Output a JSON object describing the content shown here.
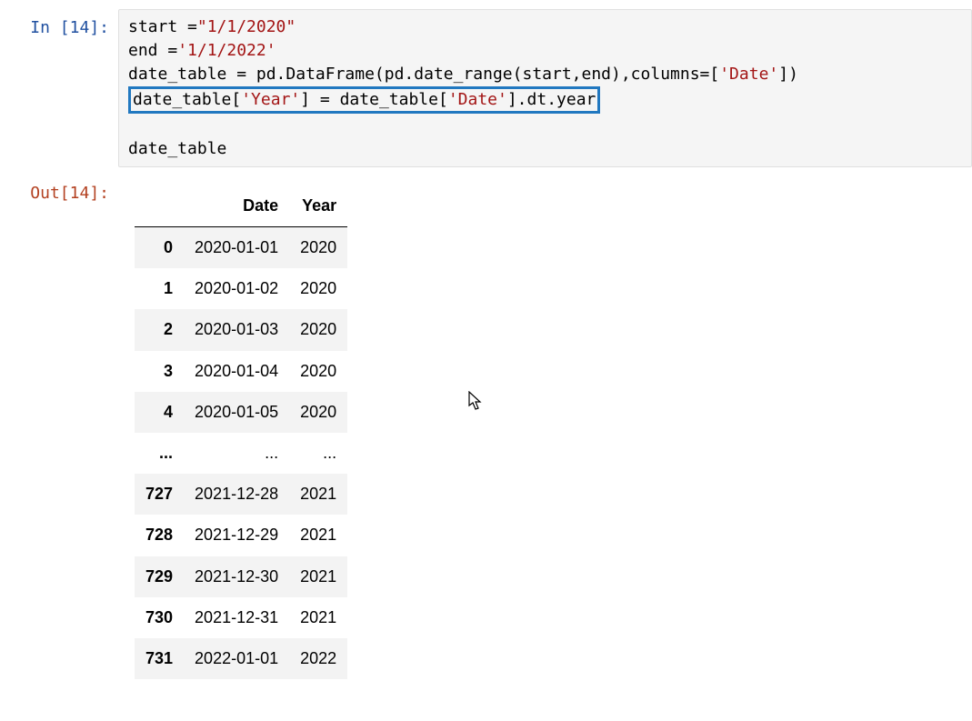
{
  "input": {
    "prompt_prefix": "In [",
    "number": "14",
    "prompt_suffix": "]:",
    "code": {
      "l1a": "start =",
      "l1b": "\"1/1/2020\"",
      "l2a": "end =",
      "l2b": "'1/1/2022'",
      "l3a": "date_table = pd.DataFrame(pd.date_range(start,end),columns=[",
      "l3b": "'Date'",
      "l3c": "])",
      "l4a": "date_table[",
      "l4b": "'Year'",
      "l4c": "] = date_table[",
      "l4d": "'Date'",
      "l4e": "].dt.year",
      "l5": "date_table"
    }
  },
  "output": {
    "prompt_prefix": "Out[",
    "number": "14",
    "prompt_suffix": "]:",
    "columns": {
      "index": "",
      "date": "Date",
      "year": "Year"
    },
    "rows": {
      "r0": {
        "i": "0",
        "d": "2020-01-01",
        "y": "2020"
      },
      "r1": {
        "i": "1",
        "d": "2020-01-02",
        "y": "2020"
      },
      "r2": {
        "i": "2",
        "d": "2020-01-03",
        "y": "2020"
      },
      "r3": {
        "i": "3",
        "d": "2020-01-04",
        "y": "2020"
      },
      "r4": {
        "i": "4",
        "d": "2020-01-05",
        "y": "2020"
      },
      "r5": {
        "i": "...",
        "d": "...",
        "y": "..."
      },
      "r6": {
        "i": "727",
        "d": "2021-12-28",
        "y": "2021"
      },
      "r7": {
        "i": "728",
        "d": "2021-12-29",
        "y": "2021"
      },
      "r8": {
        "i": "729",
        "d": "2021-12-30",
        "y": "2021"
      },
      "r9": {
        "i": "730",
        "d": "2021-12-31",
        "y": "2021"
      },
      "r10": {
        "i": "731",
        "d": "2022-01-01",
        "y": "2022"
      }
    }
  },
  "highlight_color": "#2178c0"
}
